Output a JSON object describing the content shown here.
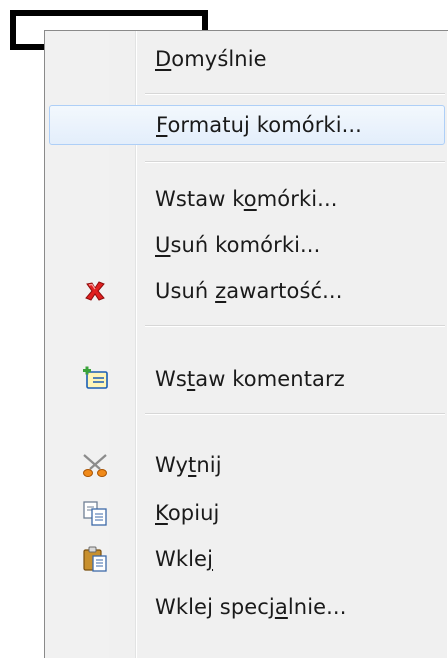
{
  "menu": {
    "items": [
      {
        "pre": "",
        "key": "D",
        "post": "omyślnie"
      },
      {
        "pre": "",
        "key": "F",
        "post": "ormatuj komórki..."
      },
      {
        "pre": "Wstaw k",
        "key": "o",
        "post": "mórki..."
      },
      {
        "pre": "",
        "key": "U",
        "post": "suń komórki..."
      },
      {
        "pre": "Usuń ",
        "key": "z",
        "post": "awartość..."
      },
      {
        "pre": "Ws",
        "key": "t",
        "post": "aw komentarz"
      },
      {
        "pre": "Wy",
        "key": "t",
        "post": "nij"
      },
      {
        "pre": "",
        "key": "K",
        "post": "opiuj"
      },
      {
        "pre": "Wkle",
        "key": "j",
        "post": ""
      },
      {
        "pre": "Wklej specj",
        "key": "a",
        "post": "lnie..."
      }
    ]
  },
  "icons": {
    "delete": "red-x-icon",
    "comment": "insert-comment-icon",
    "cut": "scissors-icon",
    "copy": "copy-icon",
    "paste": "paste-icon"
  },
  "colors": {
    "hover_border": "#aecff7",
    "hover_fill": "#e3eefb",
    "delete_red": "#d81e1e"
  }
}
